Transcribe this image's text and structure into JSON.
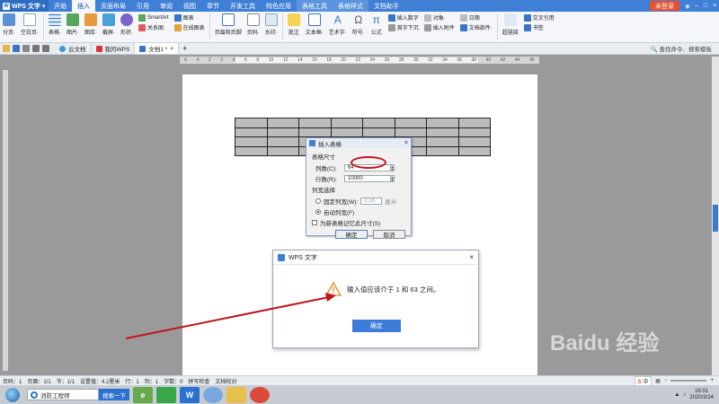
{
  "menubar": {
    "app_name": "WPS 文字",
    "items": [
      "开始",
      "插入",
      "页面布局",
      "引用",
      "审阅",
      "视图",
      "章节",
      "开发工具",
      "特色应用",
      "表格工具",
      "表格样式",
      "文档助手"
    ],
    "active_index": 1,
    "login_label": "未登录",
    "accent": "#3f80d6"
  },
  "ribbon": {
    "big_buttons": [
      {
        "label": "分页·",
        "icon": "page-break-icon"
      },
      {
        "label": "空白页·",
        "icon": "blank-page-icon"
      },
      {
        "label": "表格·",
        "icon": "table-icon"
      },
      {
        "label": "图片·",
        "icon": "picture-icon"
      },
      {
        "label": "图库·",
        "icon": "gallery-icon"
      },
      {
        "label": "截屏·",
        "icon": "screenshot-icon"
      },
      {
        "label": "形状·",
        "icon": "shape-icon"
      }
    ],
    "small_group_1": [
      "SmartArt",
      "关系图"
    ],
    "small_group_2": [
      "图表",
      "在线图表"
    ],
    "big_buttons_2": [
      {
        "label": "页眉和页脚",
        "icon": "header-footer-icon"
      },
      {
        "label": "页码·",
        "icon": "page-number-icon"
      },
      {
        "label": "水印·",
        "icon": "watermark-icon"
      },
      {
        "label": "批注",
        "icon": "comment-icon"
      },
      {
        "label": "文本框·",
        "icon": "textbox-icon"
      },
      {
        "label": "艺术字·",
        "icon": "wordart-icon"
      },
      {
        "label": "符号·",
        "icon": "symbol-icon"
      },
      {
        "label": "公式",
        "icon": "formula-icon"
      }
    ],
    "small_group_3": [
      "插入数字",
      "首字下沉",
      "对象·",
      "插入附件",
      "日期",
      "文档部件·"
    ],
    "big_buttons_3": [
      {
        "label": "超链接",
        "icon": "hyperlink-icon"
      },
      {
        "label": "书签",
        "icon": "bookmark-icon"
      },
      {
        "label": "交叉引用",
        "icon": "cross-reference-icon"
      }
    ]
  },
  "tabs": {
    "items": [
      "云文档",
      "我的WPS",
      "文档1 *"
    ],
    "active_index": 2,
    "find_command": "查找命令、搜索模板"
  },
  "ruler": {
    "numbers": [
      "6",
      "4",
      "2",
      "2",
      "4",
      "6",
      "8",
      "10",
      "12",
      "14",
      "16",
      "18",
      "20",
      "22",
      "24",
      "26",
      "28",
      "30",
      "32",
      "34",
      "36",
      "38",
      "40",
      "42",
      "44",
      "46"
    ]
  },
  "doc_table": {
    "rows": 4,
    "cols": 8
  },
  "insert_table_dialog": {
    "title": "插入表格",
    "section_size": "表格尺寸",
    "cols_label": "列数(C):",
    "cols_value": "64",
    "rows_label": "行数(R):",
    "rows_value": "10000",
    "section_width": "列宽选择",
    "fixed_width_label": "固定列宽(W):",
    "fixed_width_value": "0.16",
    "fixed_width_unit": "厘米·",
    "auto_width_label": "自动列宽(F)",
    "remember_label": "为新表格记忆此尺寸(S)",
    "ok": "确定",
    "cancel": "取消",
    "close": "×"
  },
  "alert_dialog": {
    "title": "WPS 文字",
    "message": "输入值应该介于 1 和 63 之间。",
    "ok": "确定",
    "close": "×"
  },
  "statusbar": {
    "items": [
      "页码：1",
      "页面：1/1",
      "节：1/1",
      "设置值：4.2厘米",
      "行：1",
      "列：1",
      "字数：0",
      "拼写检查",
      "文档校对"
    ],
    "ime": "中"
  },
  "taskbar": {
    "search_text": "消防工程师",
    "search_button": "搜索一下",
    "time": "16:01",
    "date": "2020/3/24"
  },
  "watermark": "Baidu 经验"
}
